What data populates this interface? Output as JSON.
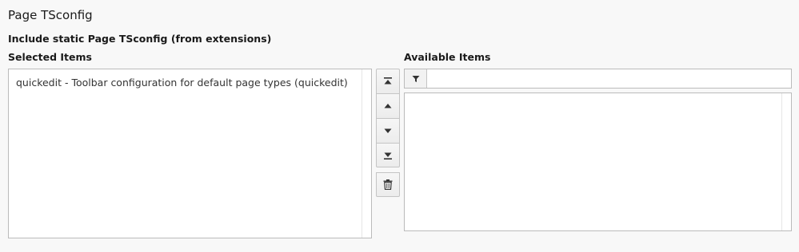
{
  "section": {
    "title": "Page TSconfig"
  },
  "field": {
    "label": "Include static Page TSconfig (from extensions)"
  },
  "selected": {
    "label": "Selected Items",
    "items": [
      "quickedit - Toolbar configuration for default page types (quickedit)"
    ]
  },
  "available": {
    "label": "Available Items",
    "filter_value": "",
    "filter_placeholder": "",
    "items": []
  },
  "buttons": {
    "move_top_icon": "move-to-top-icon",
    "move_up_icon": "move-up-icon",
    "move_down_icon": "move-down-icon",
    "move_bottom_icon": "move-to-bottom-icon",
    "remove_icon": "trash-icon",
    "filter_icon": "filter-icon"
  },
  "colors": {
    "background": "#f8f8f8",
    "border": "#bbbbbb",
    "button_border": "#c4c4c4",
    "icon": "#333333"
  }
}
